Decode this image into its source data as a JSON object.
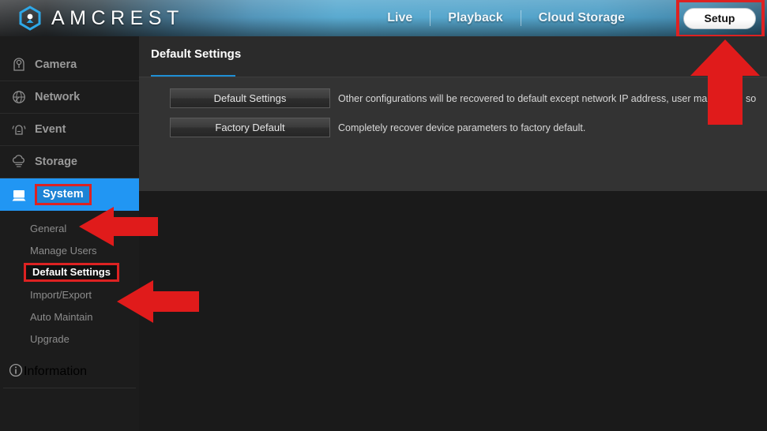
{
  "brand": {
    "name": "AMCREST",
    "logo_icon": "amcrest-hex-logo",
    "accent": "#2196f3"
  },
  "topnav": {
    "links": [
      {
        "label": "Live",
        "name": "live"
      },
      {
        "label": "Playback",
        "name": "playback"
      },
      {
        "label": "Cloud Storage",
        "name": "cloud-storage"
      }
    ],
    "setup_label": "Setup"
  },
  "sidebar": {
    "items": [
      {
        "label": "Camera",
        "icon": "camera-icon",
        "active": false
      },
      {
        "label": "Network",
        "icon": "network-globe-icon",
        "active": false
      },
      {
        "label": "Event",
        "icon": "event-alarm-icon",
        "active": false
      },
      {
        "label": "Storage",
        "icon": "storage-cloud-icon",
        "active": false
      },
      {
        "label": "System",
        "icon": "system-monitor-icon",
        "active": true
      }
    ],
    "subitems": [
      {
        "label": "General",
        "current": false
      },
      {
        "label": "Manage Users",
        "current": false
      },
      {
        "label": "Default Settings",
        "current": true
      },
      {
        "label": "Import/Export",
        "current": false
      },
      {
        "label": "Auto Maintain",
        "current": false
      },
      {
        "label": "Upgrade",
        "current": false
      }
    ],
    "information": {
      "label": "Information",
      "icon": "info-circle-icon"
    }
  },
  "content": {
    "tab_label": "Default Settings",
    "actions": [
      {
        "button_label": "Default Settings",
        "description": "Other configurations will be recovered to default except network IP address, user manage     nd so"
      },
      {
        "button_label": "Factory Default",
        "description": "Completely recover device parameters to factory default."
      }
    ]
  },
  "annotations": {
    "highlight_color": "#dd2222",
    "arrows": [
      {
        "name": "arrow-to-setup",
        "direction": "up"
      },
      {
        "name": "arrow-to-system",
        "direction": "left"
      },
      {
        "name": "arrow-to-default-settings",
        "direction": "left"
      }
    ],
    "boxes": [
      {
        "name": "setup-highlight"
      },
      {
        "name": "system-highlight"
      },
      {
        "name": "default-settings-highlight"
      }
    ]
  }
}
